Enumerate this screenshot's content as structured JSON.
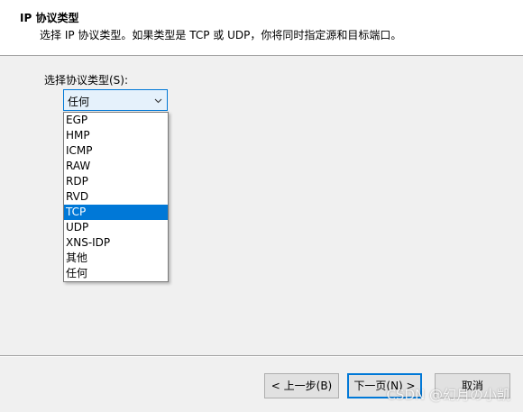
{
  "header": {
    "title": "IP 协议类型",
    "description": "选择 IP 协议类型。如果类型是 TCP 或 UDP，你将同时指定源和目标端口。"
  },
  "protocol": {
    "label": "选择协议类型(S):",
    "selected_value": "任何",
    "options": [
      "EGP",
      "HMP",
      "ICMP",
      "RAW",
      "RDP",
      "RVD",
      "TCP",
      "UDP",
      "XNS-IDP",
      "其他",
      "任何"
    ],
    "highlighted_option": "TCP"
  },
  "buttons": {
    "back": "< 上一步(B)",
    "next": "下一页(N) >",
    "cancel": "取消"
  },
  "watermark": "CSDN @幻月の小凯",
  "colors": {
    "accent": "#0078d7",
    "window_bg": "#f0f0f0",
    "header_bg": "#ffffff"
  }
}
